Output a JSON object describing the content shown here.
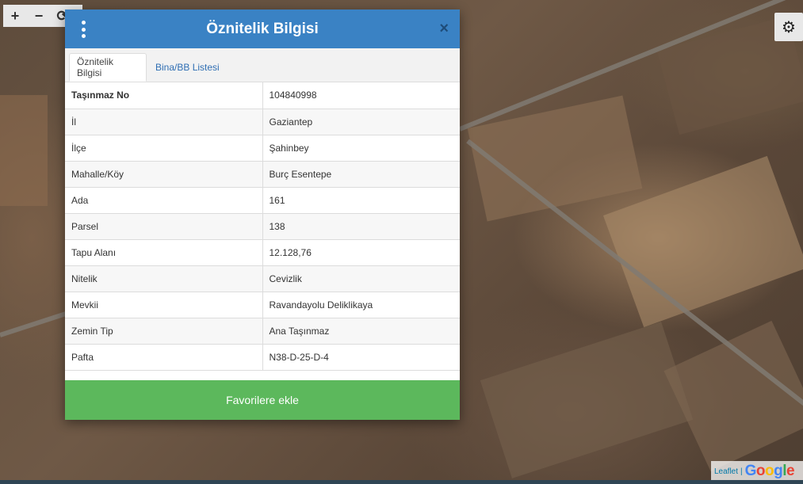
{
  "map": {
    "zoom_controls": [
      {
        "name": "zoom-in-button",
        "icon": "+"
      },
      {
        "name": "zoom-out-button",
        "icon": "−"
      },
      {
        "name": "rotate-button",
        "icon": "⟳"
      }
    ],
    "settings_icon": "⚙",
    "attribution": {
      "leaflet": "Leaflet",
      "separator": "|",
      "google": [
        "G",
        "o",
        "o",
        "g",
        "l",
        "e"
      ]
    }
  },
  "modal": {
    "title": "Öznitelik Bilgisi",
    "close_label": "×",
    "tabs": [
      {
        "label": "Öznitelik Bilgisi",
        "active": true
      },
      {
        "label": "Bina/BB Listesi",
        "active": false
      }
    ],
    "rows": [
      {
        "key": "Taşınmaz No",
        "value": "104840998"
      },
      {
        "key": "İl",
        "value": "Gaziantep"
      },
      {
        "key": "İlçe",
        "value": "Şahinbey"
      },
      {
        "key": "Mahalle/Köy",
        "value": "Burç Esentepe"
      },
      {
        "key": "Ada",
        "value": "161"
      },
      {
        "key": "Parsel",
        "value": "138"
      },
      {
        "key": "Tapu Alanı",
        "value": "12.128,76"
      },
      {
        "key": "Nitelik",
        "value": "Cevizlik"
      },
      {
        "key": "Mevkii",
        "value": "Ravandayolu Deliklikaya"
      },
      {
        "key": "Zemin Tip",
        "value": "Ana Taşınmaz"
      },
      {
        "key": "Pafta",
        "value": "N38-D-25-D-4"
      }
    ],
    "favorite_button": "Favorilere ekle"
  },
  "colors": {
    "header": "#3a82c4",
    "favorite_button": "#5cb85c",
    "tab_link": "#2f6eb3"
  }
}
